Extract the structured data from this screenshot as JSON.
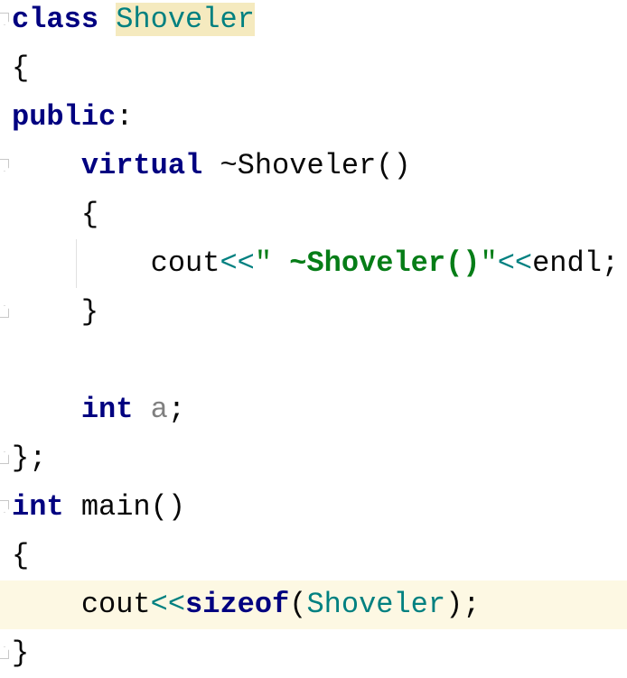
{
  "colors": {
    "keyword": "#000080",
    "class_name": "#008080",
    "string": "#067d17",
    "field": "#808080",
    "caret_line": "#fdf8e3",
    "identifier_highlight": "#f5eabf"
  },
  "lines": [
    {
      "fold": "start",
      "tokens": [
        {
          "t": "class",
          "c": "kw"
        },
        {
          "t": " "
        },
        {
          "t": "Shoveler",
          "c": "cls hl"
        }
      ]
    },
    {
      "tokens": [
        {
          "t": "{"
        }
      ]
    },
    {
      "tokens": [
        {
          "t": "public",
          "c": "kw"
        },
        {
          "t": ":"
        }
      ]
    },
    {
      "fold": "start",
      "tokens": [
        {
          "t": "    "
        },
        {
          "t": "virtual",
          "c": "kw"
        },
        {
          "t": " ~Shoveler()"
        }
      ]
    },
    {
      "tokens": [
        {
          "t": "    {"
        }
      ]
    },
    {
      "tokens": [
        {
          "t": "        cout"
        },
        {
          "t": "<<",
          "c": "op"
        },
        {
          "t": "\" ",
          "c": "str"
        },
        {
          "t": "~Shoveler()",
          "c": "strb"
        },
        {
          "t": "\"",
          "c": "str"
        },
        {
          "t": "<<",
          "c": "op"
        },
        {
          "t": "endl;"
        }
      ]
    },
    {
      "fold": "end",
      "tokens": [
        {
          "t": "    }"
        }
      ]
    },
    {
      "tokens": []
    },
    {
      "tokens": [
        {
          "t": "    "
        },
        {
          "t": "int",
          "c": "kw"
        },
        {
          "t": " "
        },
        {
          "t": "a",
          "c": "field"
        },
        {
          "t": ";"
        }
      ]
    },
    {
      "fold": "end",
      "tokens": [
        {
          "t": "};"
        }
      ]
    },
    {
      "fold": "start",
      "tokens": [
        {
          "t": "int",
          "c": "kw"
        },
        {
          "t": " main()"
        }
      ]
    },
    {
      "tokens": [
        {
          "t": "{"
        }
      ]
    },
    {
      "caret": true,
      "tokens": [
        {
          "t": "    cout"
        },
        {
          "t": "<<",
          "c": "op"
        },
        {
          "t": "sizeof",
          "c": "kw"
        },
        {
          "t": "("
        },
        {
          "t": "Shoveler",
          "c": "cls"
        },
        {
          "t": ");"
        }
      ]
    },
    {
      "fold": "end",
      "tokens": [
        {
          "t": "}"
        }
      ]
    }
  ]
}
